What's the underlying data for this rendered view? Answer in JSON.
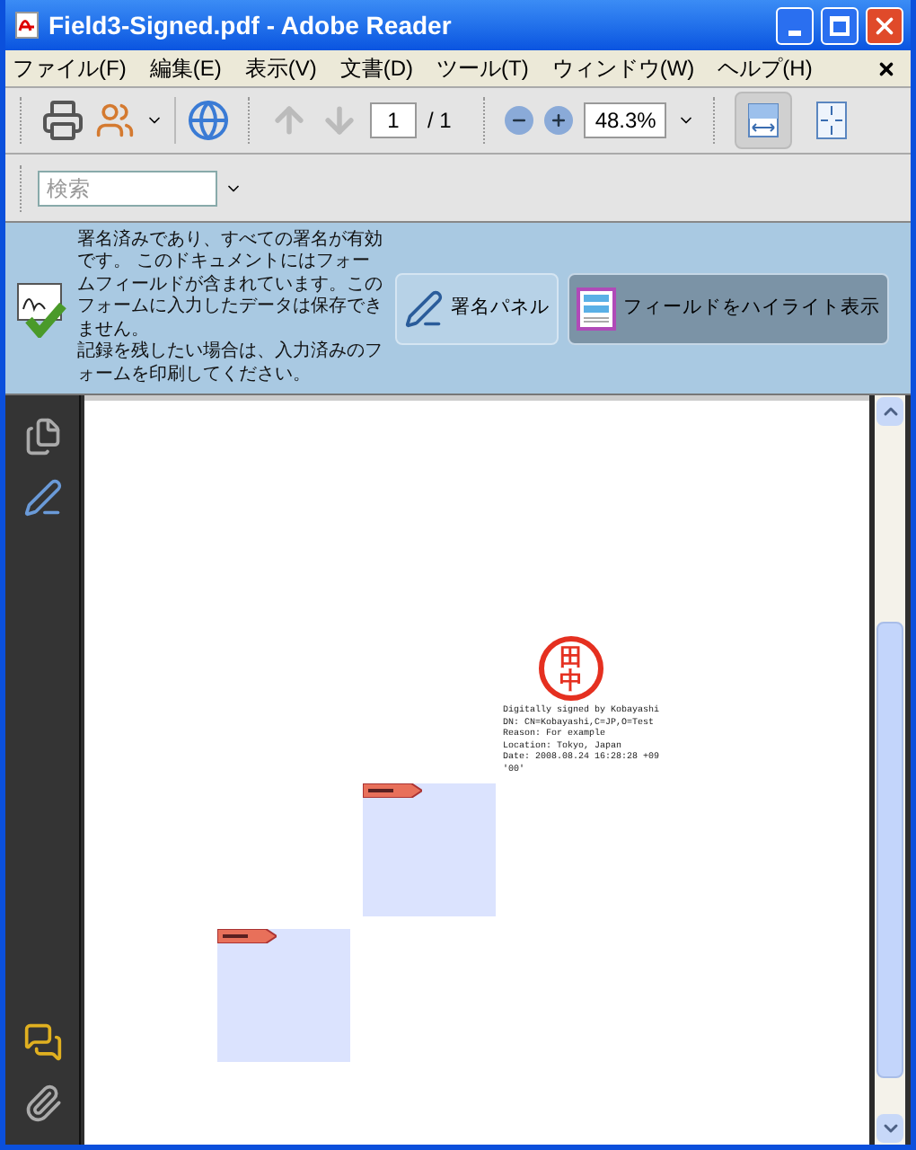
{
  "window": {
    "title": "Field3-Signed.pdf - Adobe Reader"
  },
  "menu": [
    {
      "label": "ファイル(F)"
    },
    {
      "label": "編集(E)"
    },
    {
      "label": "表示(V)"
    },
    {
      "label": "文書(D)"
    },
    {
      "label": "ツール(T)"
    },
    {
      "label": "ウィンドウ(W)"
    },
    {
      "label": "ヘルプ(H)"
    }
  ],
  "toolbar": {
    "page": "1",
    "page_total": "/ 1",
    "zoom": "48.3%",
    "fit_width": {
      "selected": true
    },
    "fit_page": {
      "selected": false
    }
  },
  "search": {
    "placeholder": "検索"
  },
  "message_bar": {
    "paragraphs": [
      "署名済みであり、すべての署名が有効です。 このドキュメントにはフォームフィールドが含まれています。このフォームに入力したデータは保存できません。",
      "記録を残したい場合は、入力済みのフォームを印刷してください。"
    ],
    "buttons": [
      {
        "kind": "signatures",
        "label": "署名パネル",
        "selected": false
      },
      {
        "kind": "highlight",
        "label": "フィールドをハイライト表示",
        "selected": true
      }
    ]
  },
  "signature": {
    "stamp": "田中",
    "lines": [
      "Digitally signed by Kobayashi",
      "DN: CN=Kobayashi,C=JP,O=Test",
      "Reason: For example",
      "Location: Tokyo, Japan",
      "Date: 2008.08.24 16:28:28 +09",
      "'00'"
    ]
  }
}
